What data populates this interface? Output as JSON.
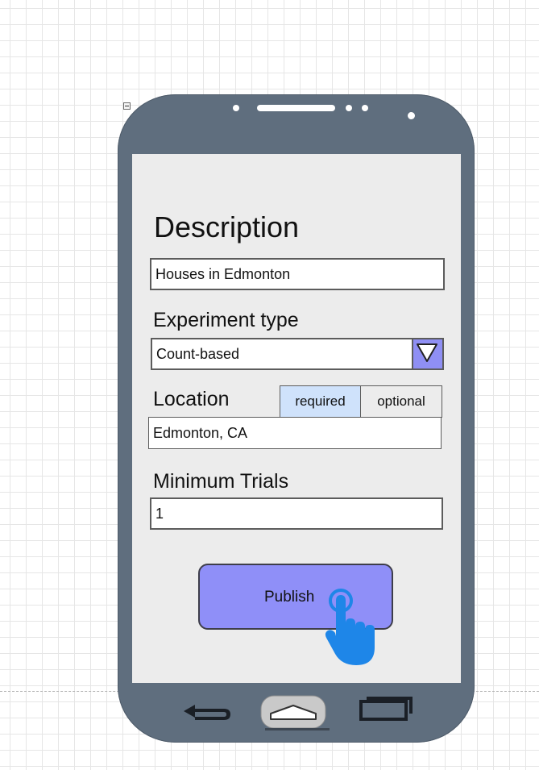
{
  "form": {
    "description_heading": "Description",
    "description_value": "Houses in Edmonton",
    "experiment_type_label": "Experiment type",
    "experiment_type_value": "Count-based",
    "location_label": "Location",
    "location_options": [
      "required",
      "optional"
    ],
    "location_selected": "required",
    "location_value": "Edmonton, CA",
    "minimum_trials_label": "Minimum Trials",
    "minimum_trials_value": "1",
    "publish_label": "Publish"
  },
  "colors": {
    "phone_body": "#5f6e7e",
    "screen_background": "#ececec",
    "accent_button": "#8f8ff8",
    "selected_segment": "#cfe2fb",
    "cursor_hand": "#1e86e8"
  },
  "icons": {
    "dropdown": "chevron-down-icon",
    "back": "back-arrow-icon",
    "home": "home-icon",
    "recent_apps": "recent-apps-icon",
    "cursor": "hand-pointer-icon",
    "collapse": "collapse-icon"
  }
}
